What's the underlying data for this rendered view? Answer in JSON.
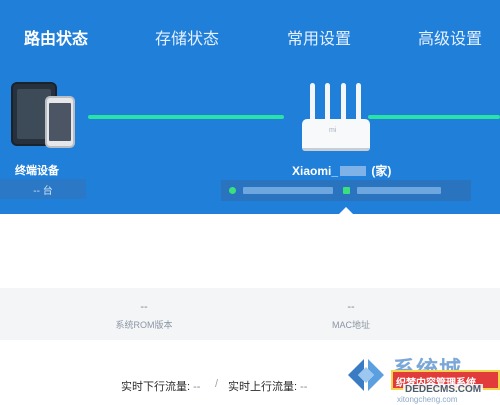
{
  "nav": {
    "tabs": [
      {
        "label": "路由状态",
        "active": true
      },
      {
        "label": "存储状态",
        "active": false
      },
      {
        "label": "常用设置",
        "active": false
      },
      {
        "label": "高级设置",
        "active": false
      }
    ]
  },
  "topology": {
    "devices_label": "终端设备",
    "devices_count": "-- 台",
    "router_name_prefix": "Xiaomi_",
    "router_name_suffix": "(家)",
    "router_logo": "mi"
  },
  "stats": {
    "rom_value": "--",
    "rom_label": "系统ROM版本",
    "mac_value": "--",
    "mac_label": "MAC地址"
  },
  "traffic": {
    "down_label": "实时下行流量:",
    "down_value": "--",
    "separator": "/",
    "up_label": "实时上行流量:",
    "up_value": "--"
  },
  "watermark": {
    "logo_text": "系统城",
    "banner_text": "织梦内容管理系统",
    "domain": "DEDECMS.COM",
    "sub": "xitongcheng.com"
  },
  "colors": {
    "header_blue": "#1f7fd9",
    "link_green": "#27e4a6",
    "status_green": "#3be07e"
  }
}
